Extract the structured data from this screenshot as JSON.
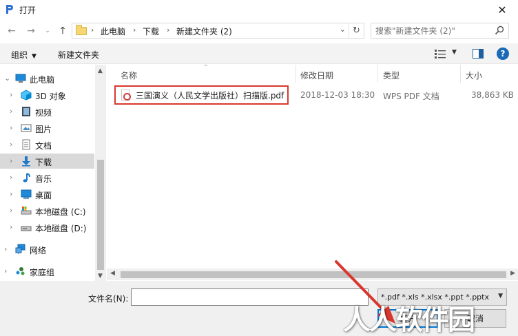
{
  "window": {
    "title": "打开",
    "close_glyph": "✕"
  },
  "address_bar": {
    "crumbs": [
      "此电脑",
      "下载",
      "新建文件夹 (2)"
    ],
    "search_placeholder": "搜索\"新建文件夹 (2)\""
  },
  "toolbar": {
    "organize_label": "组织",
    "new_folder_label": "新建文件夹",
    "help_label": "?"
  },
  "nav": {
    "items": [
      {
        "label": "此电脑",
        "icon": "computer-icon",
        "expanded": true
      },
      {
        "label": "3D 对象",
        "icon": "3d-objects-icon"
      },
      {
        "label": "视频",
        "icon": "video-icon"
      },
      {
        "label": "图片",
        "icon": "pictures-icon"
      },
      {
        "label": "文档",
        "icon": "documents-icon"
      },
      {
        "label": "下载",
        "icon": "download-icon",
        "selected": true
      },
      {
        "label": "音乐",
        "icon": "music-icon"
      },
      {
        "label": "桌面",
        "icon": "desktop-icon"
      },
      {
        "label": "本地磁盘 (C:)",
        "icon": "drive-icon"
      },
      {
        "label": "本地磁盘 (D:)",
        "icon": "drive-icon"
      },
      {
        "label": "网络",
        "icon": "network-icon"
      },
      {
        "label": "家庭组",
        "icon": "homegroup-icon"
      }
    ]
  },
  "file_list": {
    "columns": [
      "名称",
      "修改日期",
      "类型",
      "大小"
    ],
    "rows": [
      {
        "name": "三国演义（人民文学出版社）扫描版.pdf",
        "modified": "2018-12-03 18:30",
        "type": "WPS PDF 文档",
        "size": "38,863 KB",
        "icon": "pdf-file-icon"
      }
    ]
  },
  "bottom": {
    "filename_label": "文件名(N):",
    "filename_value": "",
    "filetype_value": "*.pdf *.xls *.xlsx *.ppt *.pptx",
    "open_label": "打开",
    "cancel_label": "取消"
  },
  "colors": {
    "highlight_border": "#d9372e",
    "accent": "#0078d7",
    "selected_bg": "#d9d9d9"
  }
}
